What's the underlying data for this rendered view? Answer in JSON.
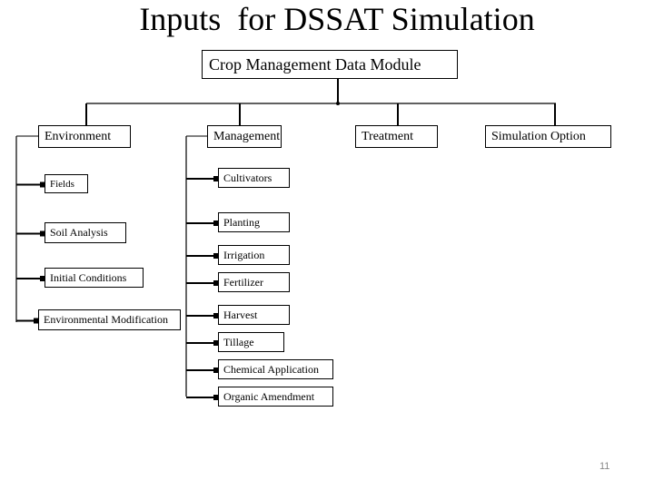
{
  "title": "Inputs  for DSSAT Simulation",
  "root": {
    "label": "Crop Management Data Module"
  },
  "categories": [
    {
      "label": "Environment",
      "children": [
        "Fields",
        "Soil Analysis",
        "Initial Conditions",
        "Environmental Modification"
      ]
    },
    {
      "label": "Management",
      "children": [
        "Cultivators",
        "Planting",
        "Irrigation",
        "Fertilizer",
        "Harvest",
        "Tillage",
        "Chemical Application",
        "Organic Amendment"
      ]
    },
    {
      "label": "Treatment",
      "children": []
    },
    {
      "label": "Simulation Option",
      "children": []
    }
  ],
  "page_number": "11",
  "colors": {
    "line": "#000000",
    "page_number": "#888888"
  }
}
